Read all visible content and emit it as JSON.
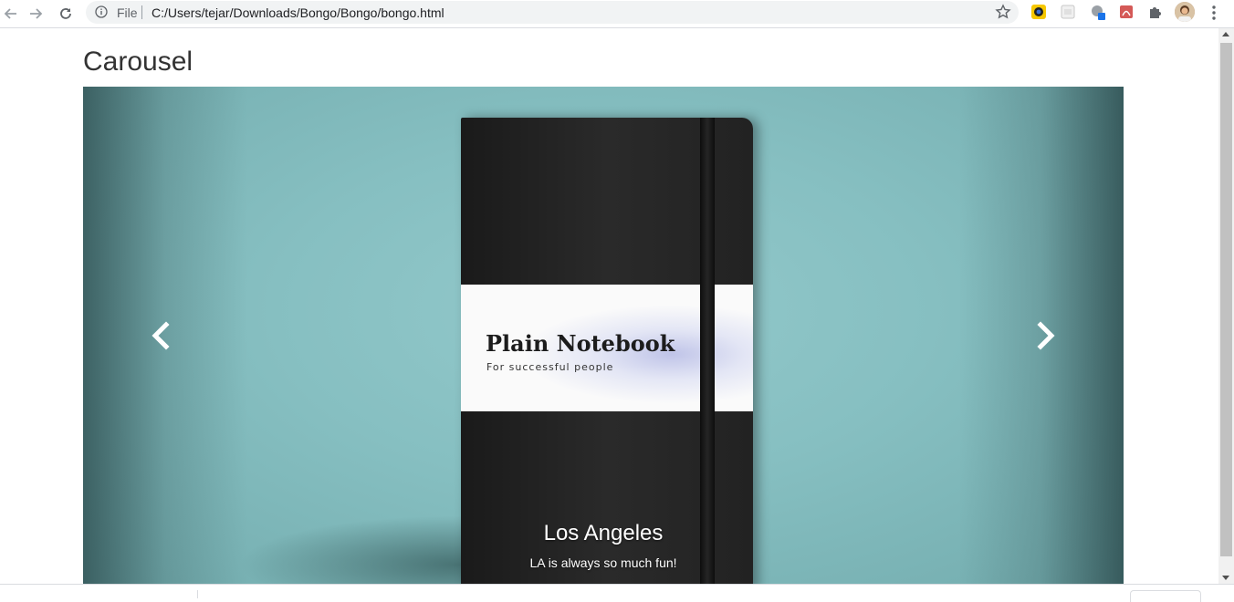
{
  "browser": {
    "url_scheme_label": "File",
    "url": "C:/Users/tejar/Downloads/Bongo/Bongo/bongo.html"
  },
  "page": {
    "title": "Carousel"
  },
  "carousel": {
    "product_title": "Plain Notebook",
    "product_subtitle": "For successful people",
    "caption_title": "Los Angeles",
    "caption_text": "LA is always so much fun!",
    "prev_icon": "chevron-left-icon",
    "next_icon": "chevron-right-icon"
  },
  "colors": {
    "backdrop": "#8cc4c6",
    "notebook": "#222222",
    "caption": "#ffffff"
  }
}
